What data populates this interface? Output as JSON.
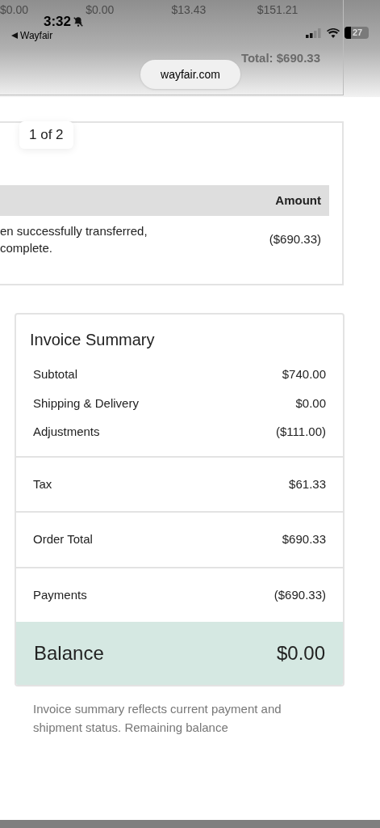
{
  "status_bar": {
    "time": "3:32",
    "back_label": "Wayfair",
    "battery": "27"
  },
  "url_pill": "wayfair.com",
  "top_card": {
    "amounts": [
      "$0.00",
      "$0.00",
      "$13.43",
      "$151.21"
    ],
    "total": "Total: $690.33"
  },
  "page_badge": "1 of 2",
  "payments_card": {
    "columns": [
      "Amount"
    ],
    "rows": [
      {
        "description": "en successfully transferred,\ncomplete.",
        "amount": "($690.33)"
      }
    ]
  },
  "summary": {
    "title": "Invoice Summary",
    "groups": [
      [
        {
          "label": "Subtotal",
          "value": "$740.00"
        },
        {
          "label": "Shipping & Delivery",
          "value": "$0.00"
        },
        {
          "label": "Adjustments",
          "value": "($111.00)"
        }
      ],
      [
        {
          "label": "Tax",
          "value": "$61.33"
        }
      ],
      [
        {
          "label": "Order Total",
          "value": "$690.33"
        }
      ],
      [
        {
          "label": "Payments",
          "value": "($690.33)"
        }
      ]
    ],
    "balance": {
      "label": "Balance",
      "value": "$0.00"
    }
  },
  "note": "Invoice summary reflects current payment and shipment status. Remaining balance"
}
